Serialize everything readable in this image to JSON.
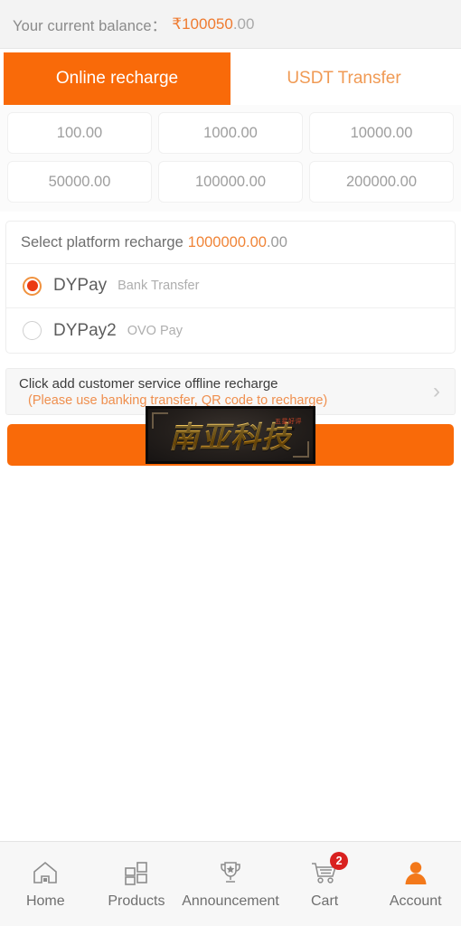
{
  "header": {
    "balance_label": "Your current balance：",
    "balance_amount": "₹100050",
    "balance_decimals": ".00"
  },
  "tabs": [
    {
      "label": "Online recharge",
      "active": true
    },
    {
      "label": "USDT Transfer",
      "active": false
    }
  ],
  "amounts": [
    "100.00",
    "1000.00",
    "10000.00",
    "50000.00",
    "100000.00",
    "200000.00"
  ],
  "platform": {
    "title": "Select platform recharge",
    "amount": "1000000.00",
    "amount_decimals": ".00",
    "methods": [
      {
        "name": "DYPay",
        "sub": "Bank Transfer",
        "selected": true
      },
      {
        "name": "DYPay2",
        "sub": "OVO Pay",
        "selected": false
      }
    ]
  },
  "offline": {
    "main": "Click add customer service offline recharge",
    "sub": "(Please use banking transfer, QR code to recharge)",
    "chevron": "›"
  },
  "submit": {
    "label": "",
    "logo_text": "南亚科技",
    "logo_badge": "五星好评"
  },
  "bottom_nav": [
    {
      "label": "Home",
      "icon": "home-icon",
      "active": false,
      "badge": ""
    },
    {
      "label": "Products",
      "icon": "grid-icon",
      "active": false,
      "badge": ""
    },
    {
      "label": "Announcement",
      "icon": "trophy-icon",
      "active": false,
      "badge": ""
    },
    {
      "label": "Cart",
      "icon": "cart-icon",
      "active": false,
      "badge": "2"
    },
    {
      "label": "Account",
      "icon": "person-icon",
      "active": true,
      "badge": ""
    }
  ],
  "colors": {
    "accent": "#f96a09",
    "accent_text": "#ef7b30",
    "badge_red": "#d9211f",
    "radio_fill": "#eb3a12"
  }
}
